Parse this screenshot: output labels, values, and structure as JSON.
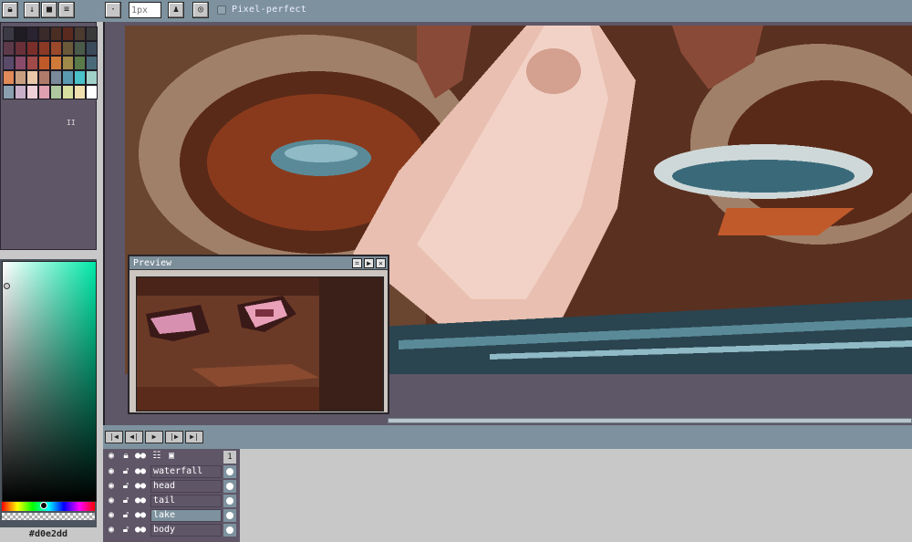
{
  "toolbar": {
    "lock_icon": "lock-icon",
    "download_icon": "download-icon",
    "save_icon": "save-icon",
    "menu_icon": "menu-icon",
    "dot_icon": "dot-icon",
    "brush_size_placeholder": "1px",
    "pixel_perfect_label": "Pixel-perfect"
  },
  "palette": {
    "extra_label": "II",
    "colors": [
      "#3b3a44",
      "#1f1c24",
      "#2a2330",
      "#3a2a2a",
      "#4a2e24",
      "#5a2a1e",
      "#4a3a30",
      "#3a3a3a",
      "#5e3a48",
      "#6a3038",
      "#7a2e2a",
      "#8a3a24",
      "#9a4a2a",
      "#6a5a3a",
      "#4a5a4a",
      "#3a4a5a",
      "#5a4a6a",
      "#8a4a6a",
      "#a04a4a",
      "#c05a2a",
      "#d07a3a",
      "#a08a4a",
      "#5a7a4a",
      "#4a6a7a",
      "#e08a5a",
      "#c8a080",
      "#e8c8a8",
      "#b07a6a",
      "#7a8a9a",
      "#5a9ab0",
      "#4ac0c8",
      "#a0d0c8",
      "#8aa0b0",
      "#c8b0c8",
      "#f0d0d8",
      "#e0a0b0",
      "#b0c8a0",
      "#d8e0a0",
      "#f0e0b0",
      "#ffffff"
    ]
  },
  "color_picker": {
    "hex": "#d0e2dd"
  },
  "preview": {
    "title": "Preview"
  },
  "playback": {
    "first": "first-frame-icon",
    "prev": "prev-frame-icon",
    "play": "play-icon",
    "next": "next-frame-icon",
    "last": "last-frame-icon"
  },
  "layers": {
    "frame_number": "1",
    "rows": [
      {
        "name": "waterfall",
        "selected": false
      },
      {
        "name": "head",
        "selected": false
      },
      {
        "name": "tail",
        "selected": false
      },
      {
        "name": "lake",
        "selected": true
      },
      {
        "name": "body",
        "selected": false
      }
    ]
  },
  "colors": {
    "toolbar_bg": "#7d929e",
    "panel_bg": "#5f5667",
    "selection": "#7d929e"
  }
}
